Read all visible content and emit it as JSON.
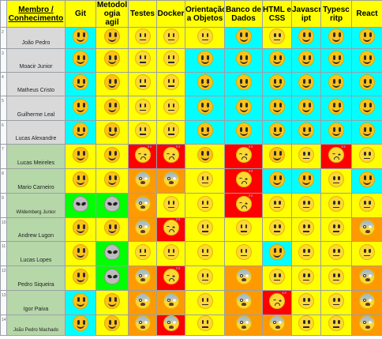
{
  "colors": {
    "header": "#ffff00",
    "cyan": "#00ffff",
    "yellow": "#ffff00",
    "red": "#ff0000",
    "orange": "#ff9900",
    "green": "#00ff00",
    "name_green": "#b6d7a8",
    "name_grey": "#d9d9d9"
  },
  "headers": [
    "Membro / Conhecimento",
    "Git",
    "Metodol ogia agil",
    "Testes",
    "Docker",
    "Orientação a Objetos",
    "Banco de Dados",
    "HTML e CSS",
    "Javascr ipt",
    "Typesc ritp",
    "React"
  ],
  "rows": [
    {
      "num": "2",
      "name": "João Pedro",
      "name_bg": "grey",
      "cells": [
        [
          "smile",
          "cyan"
        ],
        [
          "smile",
          "yellow"
        ],
        [
          "neutral",
          "yellow"
        ],
        [
          "neutral",
          "yellow"
        ],
        [
          "neutral",
          "yellow"
        ],
        [
          "smile",
          "cyan"
        ],
        [
          "neutral",
          "yellow"
        ],
        [
          "smile",
          "cyan"
        ],
        [
          "smile",
          "cyan"
        ],
        [
          "smile",
          "cyan"
        ]
      ]
    },
    {
      "num": "3",
      "name": "Moacir Junior",
      "name_bg": "grey",
      "cells": [
        [
          "smile",
          "cyan"
        ],
        [
          "smile",
          "yellow"
        ],
        [
          "neutral",
          "yellow"
        ],
        [
          "neutral",
          "yellow"
        ],
        [
          "smile",
          "cyan"
        ],
        [
          "smile",
          "cyan"
        ],
        [
          "smile",
          "cyan"
        ],
        [
          "smile",
          "cyan"
        ],
        [
          "smile",
          "cyan"
        ],
        [
          "smile",
          "cyan"
        ]
      ]
    },
    {
      "num": "4",
      "name": "Matheus Cristo",
      "name_bg": "grey",
      "cells": [
        [
          "smile",
          "cyan"
        ],
        [
          "smile",
          "yellow"
        ],
        [
          "neutral",
          "yellow"
        ],
        [
          "neutral",
          "yellow"
        ],
        [
          "smile",
          "cyan"
        ],
        [
          "smile",
          "cyan"
        ],
        [
          "smile",
          "cyan"
        ],
        [
          "smile",
          "cyan"
        ],
        [
          "smile",
          "cyan"
        ],
        [
          "smile",
          "cyan"
        ]
      ]
    },
    {
      "num": "5",
      "name": "Guilherme Leal",
      "name_bg": "grey",
      "cells": [
        [
          "smile",
          "cyan"
        ],
        [
          "smile",
          "yellow"
        ],
        [
          "neutral",
          "yellow"
        ],
        [
          "neutral",
          "yellow"
        ],
        [
          "smile",
          "cyan"
        ],
        [
          "smile",
          "cyan"
        ],
        [
          "smile",
          "cyan"
        ],
        [
          "smile",
          "cyan"
        ],
        [
          "smile",
          "cyan"
        ],
        [
          "smile",
          "cyan"
        ]
      ]
    },
    {
      "num": "6",
      "name": "Lucas Alexandre",
      "name_bg": "grey",
      "cells": [
        [
          "smile",
          "cyan"
        ],
        [
          "smile",
          "yellow"
        ],
        [
          "neutral",
          "yellow"
        ],
        [
          "neutral",
          "yellow"
        ],
        [
          "smile",
          "cyan"
        ],
        [
          "smile",
          "cyan"
        ],
        [
          "smile",
          "cyan"
        ],
        [
          "smile",
          "cyan"
        ],
        [
          "smile",
          "cyan"
        ],
        [
          "smile",
          "cyan"
        ]
      ]
    },
    {
      "num": "7",
      "name": "Lucas Meireles",
      "name_bg": "green",
      "cells": [
        [
          "smile",
          "yellow"
        ],
        [
          "smile",
          "yellow"
        ],
        [
          "sleepy",
          "red"
        ],
        [
          "sleepy",
          "red"
        ],
        [
          "smile",
          "yellow"
        ],
        [
          "sleepy",
          "red"
        ],
        [
          "smile",
          "yellow"
        ],
        [
          "neutral",
          "yellow"
        ],
        [
          "sleepy",
          "red"
        ],
        [
          "neutral",
          "yellow"
        ]
      ]
    },
    {
      "num": "8",
      "name": "Mario Carneiro",
      "name_bg": "green",
      "cells": [
        [
          "smile",
          "yellow"
        ],
        [
          "smile",
          "yellow"
        ],
        [
          "fear",
          "orange"
        ],
        [
          "fear",
          "orange"
        ],
        [
          "neutral",
          "yellow"
        ],
        [
          "sleepy",
          "red"
        ],
        [
          "smile",
          "cyan"
        ],
        [
          "smile",
          "cyan"
        ],
        [
          "neutral",
          "yellow"
        ],
        [
          "smile",
          "cyan"
        ]
      ]
    },
    {
      "num": "9",
      "name": "Wildemberg Junior",
      "name_bg": "green",
      "cells": [
        [
          "alien",
          "green"
        ],
        [
          "alien",
          "green"
        ],
        [
          "fear",
          "orange"
        ],
        [
          "neutral",
          "yellow"
        ],
        [
          "neutral",
          "yellow"
        ],
        [
          "sleepy",
          "red"
        ],
        [
          "neutral",
          "yellow"
        ],
        [
          "neutral",
          "yellow"
        ],
        [
          "neutral",
          "yellow"
        ],
        [
          "neutral",
          "yellow"
        ]
      ]
    },
    {
      "num": "10",
      "name": "Andrew Lugon",
      "name_bg": "green",
      "cells": [
        [
          "smile",
          "yellow"
        ],
        [
          "smile",
          "yellow"
        ],
        [
          "fear",
          "orange"
        ],
        [
          "sleepy",
          "red"
        ],
        [
          "neutral",
          "yellow"
        ],
        [
          "neutral",
          "yellow"
        ],
        [
          "neutral",
          "yellow"
        ],
        [
          "neutral",
          "yellow"
        ],
        [
          "neutral",
          "yellow"
        ],
        [
          "fear",
          "orange"
        ]
      ]
    },
    {
      "num": "11",
      "name": "Lucas Lopes",
      "name_bg": "green",
      "cells": [
        [
          "smile",
          "yellow"
        ],
        [
          "alien",
          "green"
        ],
        [
          "neutral",
          "yellow"
        ],
        [
          "neutral",
          "yellow"
        ],
        [
          "neutral",
          "yellow"
        ],
        [
          "neutral",
          "yellow"
        ],
        [
          "smile",
          "cyan"
        ],
        [
          "neutral",
          "yellow"
        ],
        [
          "neutral",
          "yellow"
        ],
        [
          "neutral",
          "yellow"
        ]
      ]
    },
    {
      "num": "12",
      "name": "Pedro Siqueira",
      "name_bg": "green",
      "cells": [
        [
          "smile",
          "yellow"
        ],
        [
          "alien",
          "green"
        ],
        [
          "fear",
          "orange"
        ],
        [
          "sleepy",
          "red"
        ],
        [
          "neutral",
          "yellow"
        ],
        [
          "fear",
          "orange"
        ],
        [
          "neutral",
          "yellow"
        ],
        [
          "neutral",
          "yellow"
        ],
        [
          "neutral",
          "yellow"
        ],
        [
          "fear",
          "orange"
        ]
      ]
    },
    {
      "num": "13",
      "name": "Igor Paiva",
      "name_bg": "green",
      "cells": [
        [
          "smile",
          "cyan"
        ],
        [
          "smile",
          "yellow"
        ],
        [
          "fear",
          "orange"
        ],
        [
          "fear",
          "orange"
        ],
        [
          "neutral",
          "yellow"
        ],
        [
          "fear",
          "orange"
        ],
        [
          "sleepy",
          "red"
        ],
        [
          "neutral",
          "yellow"
        ],
        [
          "neutral",
          "yellow"
        ],
        [
          "fear",
          "orange"
        ]
      ]
    },
    {
      "num": "14",
      "name": "João Pedro Machado",
      "name_bg": "green",
      "cells": [
        [
          "smile",
          "cyan"
        ],
        [
          "smile",
          "yellow"
        ],
        [
          "fear",
          "orange"
        ],
        [
          "fear",
          "red"
        ],
        [
          "neutral",
          "yellow"
        ],
        [
          "fear",
          "orange"
        ],
        [
          "fear",
          "orange"
        ],
        [
          "neutral",
          "yellow"
        ],
        [
          "neutral",
          "yellow"
        ],
        [
          "fear",
          "orange"
        ]
      ]
    }
  ]
}
